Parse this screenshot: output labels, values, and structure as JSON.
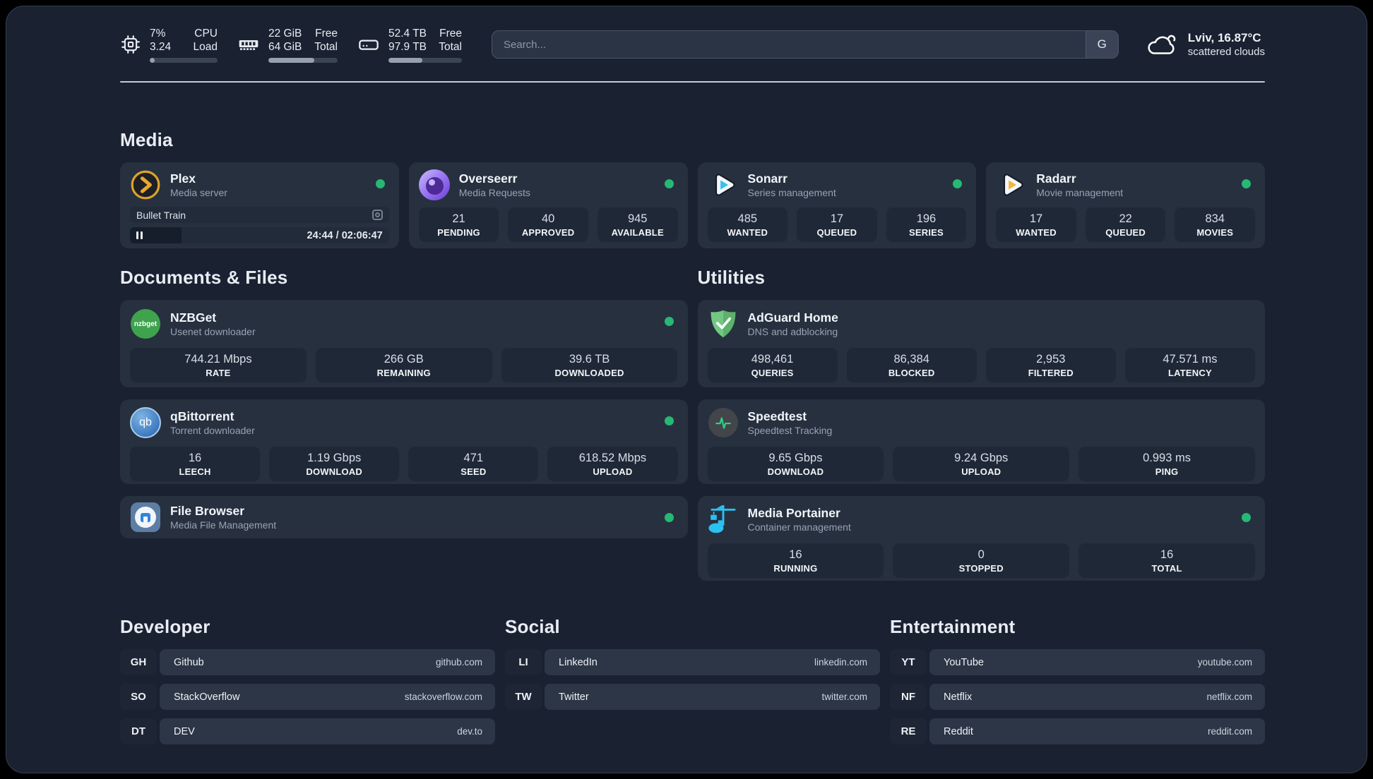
{
  "topbar": {
    "cpu": {
      "values": [
        "7%",
        "3.24"
      ],
      "labels": [
        "CPU",
        "Load"
      ],
      "progress": "7%"
    },
    "memory": {
      "values": [
        "22 GiB",
        "64 GiB"
      ],
      "labels": [
        "Free",
        "Total"
      ],
      "progress": "66%"
    },
    "disk": {
      "values": [
        "52.4 TB",
        "97.9 TB"
      ],
      "labels": [
        "Free",
        "Total"
      ],
      "progress": "46%"
    },
    "search": {
      "placeholder": "Search...",
      "button_label": "G"
    },
    "weather": {
      "location_temp": "Lviv, 16.87°C",
      "condition": "scattered clouds"
    }
  },
  "media": {
    "title": "Media",
    "plex": {
      "title": "Plex",
      "subtitle": "Media server",
      "player_title": "Bullet Train",
      "player_time": "24:44 / 02:06:47",
      "player_progress": "20%"
    },
    "overseerr": {
      "title": "Overseerr",
      "subtitle": "Media Requests",
      "stats": [
        {
          "value": "21",
          "label": "PENDING"
        },
        {
          "value": "40",
          "label": "APPROVED"
        },
        {
          "value": "945",
          "label": "AVAILABLE"
        }
      ]
    },
    "sonarr": {
      "title": "Sonarr",
      "subtitle": "Series management",
      "stats": [
        {
          "value": "485",
          "label": "WANTED"
        },
        {
          "value": "17",
          "label": "QUEUED"
        },
        {
          "value": "196",
          "label": "SERIES"
        }
      ]
    },
    "radarr": {
      "title": "Radarr",
      "subtitle": "Movie management",
      "stats": [
        {
          "value": "17",
          "label": "WANTED"
        },
        {
          "value": "22",
          "label": "QUEUED"
        },
        {
          "value": "834",
          "label": "MOVIES"
        }
      ]
    }
  },
  "documents": {
    "title": "Documents & Files",
    "nzbget": {
      "title": "NZBGet",
      "subtitle": "Usenet downloader",
      "icon_label": "nzbget",
      "stats": [
        {
          "value": "744.21 Mbps",
          "label": "RATE"
        },
        {
          "value": "266 GB",
          "label": "REMAINING"
        },
        {
          "value": "39.6 TB",
          "label": "DOWNLOADED"
        }
      ]
    },
    "qbittorrent": {
      "title": "qBittorrent",
      "subtitle": "Torrent downloader",
      "icon_label": "qb",
      "stats": [
        {
          "value": "16",
          "label": "LEECH"
        },
        {
          "value": "1.19 Gbps",
          "label": "DOWNLOAD"
        },
        {
          "value": "471",
          "label": "SEED"
        },
        {
          "value": "618.52 Mbps",
          "label": "UPLOAD"
        }
      ]
    },
    "filebrowser": {
      "title": "File Browser",
      "subtitle": "Media File Management"
    }
  },
  "utilities": {
    "title": "Utilities",
    "adguard": {
      "title": "AdGuard Home",
      "subtitle": "DNS and adblocking",
      "stats": [
        {
          "value": "498,461",
          "label": "QUERIES"
        },
        {
          "value": "86,384",
          "label": "BLOCKED"
        },
        {
          "value": "2,953",
          "label": "FILTERED"
        },
        {
          "value": "47.571 ms",
          "label": "LATENCY"
        }
      ]
    },
    "speedtest": {
      "title": "Speedtest",
      "subtitle": "Speedtest Tracking",
      "stats": [
        {
          "value": "9.65 Gbps",
          "label": "DOWNLOAD"
        },
        {
          "value": "9.24 Gbps",
          "label": "UPLOAD"
        },
        {
          "value": "0.993 ms",
          "label": "PING"
        }
      ]
    },
    "portainer": {
      "title": "Media Portainer",
      "subtitle": "Container management",
      "stats": [
        {
          "value": "16",
          "label": "RUNNING"
        },
        {
          "value": "0",
          "label": "STOPPED"
        },
        {
          "value": "16",
          "label": "TOTAL"
        }
      ]
    }
  },
  "bookmarks": {
    "developer": {
      "title": "Developer",
      "items": [
        {
          "abbr": "GH",
          "name": "Github",
          "url": "github.com"
        },
        {
          "abbr": "SO",
          "name": "StackOverflow",
          "url": "stackoverflow.com"
        },
        {
          "abbr": "DT",
          "name": "DEV",
          "url": "dev.to"
        }
      ]
    },
    "social": {
      "title": "Social",
      "items": [
        {
          "abbr": "LI",
          "name": "LinkedIn",
          "url": "linkedin.com"
        },
        {
          "abbr": "TW",
          "name": "Twitter",
          "url": "twitter.com"
        }
      ]
    },
    "entertainment": {
      "title": "Entertainment",
      "items": [
        {
          "abbr": "YT",
          "name": "YouTube",
          "url": "youtube.com"
        },
        {
          "abbr": "NF",
          "name": "Netflix",
          "url": "netflix.com"
        },
        {
          "abbr": "RE",
          "name": "Reddit",
          "url": "reddit.com"
        }
      ]
    }
  },
  "colors": {
    "status_online": "#26b874",
    "accent_blue": "#2bc0f0"
  }
}
